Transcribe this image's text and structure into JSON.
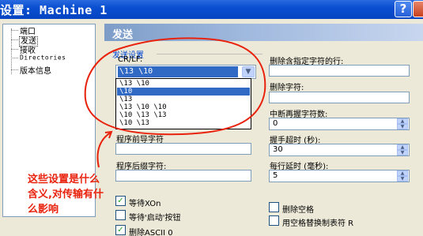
{
  "window": {
    "title": "设置: Machine 1",
    "help_label": "?"
  },
  "tree": {
    "items": [
      "端口",
      "发送",
      "接收",
      "Directories",
      "版本信息"
    ],
    "selected": "发送"
  },
  "panel": {
    "header": "发送",
    "group_label": "发送设置",
    "crlf_label": "CR/LF:",
    "crlf_value": "\\13 \\10",
    "crlf_options": [
      "\\13 \\10",
      "\\10",
      "\\13",
      "\\13 \\10 \\10",
      "\\10 \\13 \\13",
      "\\10 \\13"
    ],
    "crlf_selected_option": "\\10",
    "program_prefix_label": "程序前导字符",
    "program_suffix_label": "程序后缀字符:",
    "delete_line_label": "删除含指定字符的行:",
    "delete_char_label": "删除字符:",
    "retry_count_label": "中断再握字符数:",
    "retry_count_value": "0",
    "handshake_timeout_label": "握手超时 (秒):",
    "handshake_timeout_value": "30",
    "line_delay_label": "每行延时 (毫秒):",
    "line_delay_value": "5",
    "checkboxes": [
      {
        "label": "等待XOn",
        "checked": true
      },
      {
        "label": "等待'启动'按钮",
        "checked": false
      },
      {
        "label": "删除ASCII 0",
        "checked": true
      },
      {
        "label": "删除空格",
        "checked": false
      },
      {
        "label": "用空格替换制表符 R",
        "checked": false
      }
    ]
  },
  "annotation": {
    "text": "这些设置是什么含义,对传输有什么影响",
    "color": "#e8220c"
  },
  "colors": {
    "titlebar": "#0a4fd0",
    "panel_bg": "#ece9d8",
    "selection": "#316ac5",
    "group_label": "#0046d5"
  }
}
